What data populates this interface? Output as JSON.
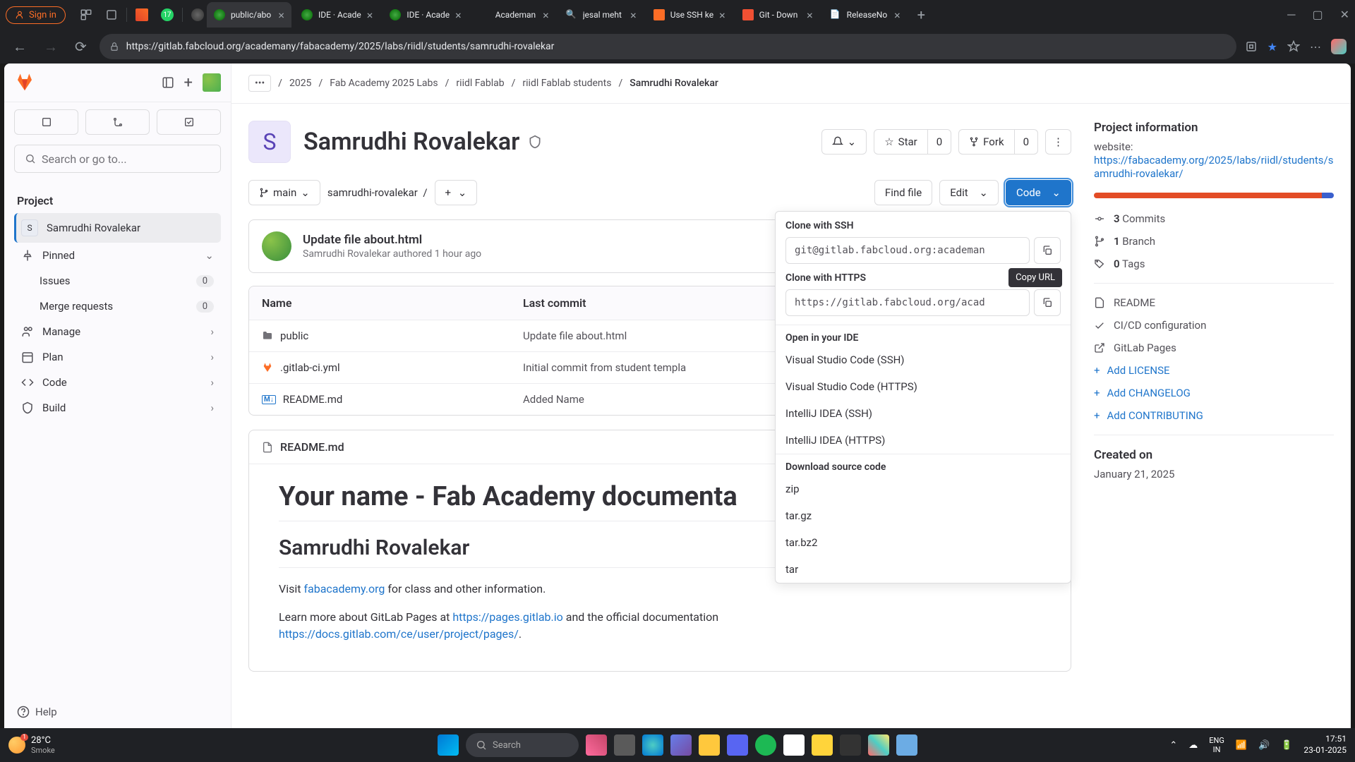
{
  "chrome": {
    "sign_in": "Sign in",
    "tabs": [
      {
        "label": "public/abo",
        "favicon": "gitlab"
      },
      {
        "label": "IDE · Acade",
        "favicon": "gitlab"
      },
      {
        "label": "IDE · Acade",
        "favicon": "gitlab"
      },
      {
        "label": "Academan",
        "favicon": "none"
      },
      {
        "label": "jesal meht",
        "favicon": "search"
      },
      {
        "label": "Use SSH ke",
        "favicon": "gitlab-orange"
      },
      {
        "label": "Git - Down",
        "favicon": "git"
      },
      {
        "label": "ReleaseNo",
        "favicon": "doc"
      }
    ],
    "url": "https://gitlab.fabcloud.org/academany/fabacademy/2025/labs/riidl/students/samrudhi-rovalekar"
  },
  "sidebar": {
    "search_placeholder": "Search or go to...",
    "project_label": "Project",
    "current_project": "Samrudhi Rovalekar",
    "pinned": "Pinned",
    "issues": "Issues",
    "issues_count": "0",
    "merge_requests": "Merge requests",
    "mr_count": "0",
    "manage": "Manage",
    "plan": "Plan",
    "code": "Code",
    "build": "Build",
    "help": "Help"
  },
  "breadcrumbs": {
    "more": "•••",
    "items": [
      "2025",
      "Fab Academy 2025 Labs",
      "riidl Fablab",
      "riidl Fablab students"
    ],
    "current": "Samrudhi Rovalekar"
  },
  "project": {
    "initial": "S",
    "name": "Samrudhi Rovalekar",
    "star": "Star",
    "star_count": "0",
    "fork": "Fork",
    "fork_count": "0"
  },
  "toolbar": {
    "branch": "main",
    "path": "samrudhi-rovalekar",
    "find_file": "Find file",
    "edit": "Edit",
    "code": "Code"
  },
  "code_dropdown": {
    "ssh_label": "Clone with SSH",
    "ssh_url": "git@gitlab.fabcloud.org:academan",
    "https_label": "Clone with HTTPS",
    "https_url": "https://gitlab.fabcloud.org/acad",
    "tooltip": "Copy URL",
    "open_ide": "Open in your IDE",
    "vs_ssh": "Visual Studio Code (SSH)",
    "vs_https": "Visual Studio Code (HTTPS)",
    "ij_ssh": "IntelliJ IDEA (SSH)",
    "ij_https": "IntelliJ IDEA (HTTPS)",
    "download": "Download source code",
    "zip": "zip",
    "targz": "tar.gz",
    "tarbz2": "tar.bz2",
    "tar": "tar"
  },
  "commit": {
    "title": "Update file about.html",
    "author": "Samrudhi Rovalekar",
    "meta": " authored 1 hour ago"
  },
  "files": {
    "col_name": "Name",
    "col_commit": "Last commit",
    "rows": [
      {
        "name": "public",
        "commit": "Update file about.html",
        "type": "folder"
      },
      {
        "name": ".gitlab-ci.yml",
        "commit": "Initial commit from student templa",
        "type": "gitlab"
      },
      {
        "name": "README.md",
        "commit": "Added Name",
        "type": "md"
      }
    ]
  },
  "readme": {
    "filename": "README.md",
    "h1": "Your name - Fab Academy documenta",
    "h2": "Samrudhi Rovalekar",
    "p1_a": "Visit ",
    "p1_link": "fabacademy.org",
    "p1_b": " for class and other information.",
    "p2_a": "Learn more about GitLab Pages at ",
    "p2_link1": "https://pages.gitlab.io",
    "p2_b": " and the official documentation ",
    "p2_link2": "https://docs.gitlab.com/ce/user/project/pages/",
    "p2_c": "."
  },
  "sidepanel": {
    "title": "Project information",
    "website": "website:",
    "website_url": "https://fabacademy.org/2025/labs/riidl/students/samrudhi-rovalekar/",
    "commits_n": "3",
    "commits": " Commits",
    "branch_n": "1",
    "branch": " Branch",
    "tags_n": "0",
    "tags": " Tags",
    "readme": "README",
    "cicd": "CI/CD configuration",
    "pages": "GitLab Pages",
    "add_license": "Add LICENSE",
    "add_changelog": "Add CHANGELOG",
    "add_contributing": "Add CONTRIBUTING",
    "created_on": "Created on",
    "created_date": "January 21, 2025"
  },
  "taskbar": {
    "temp": "28°C",
    "weather": "Smoke",
    "search": "Search",
    "lang1": "ENG",
    "lang2": "IN",
    "time": "17:51",
    "date": "23-01-2025"
  }
}
